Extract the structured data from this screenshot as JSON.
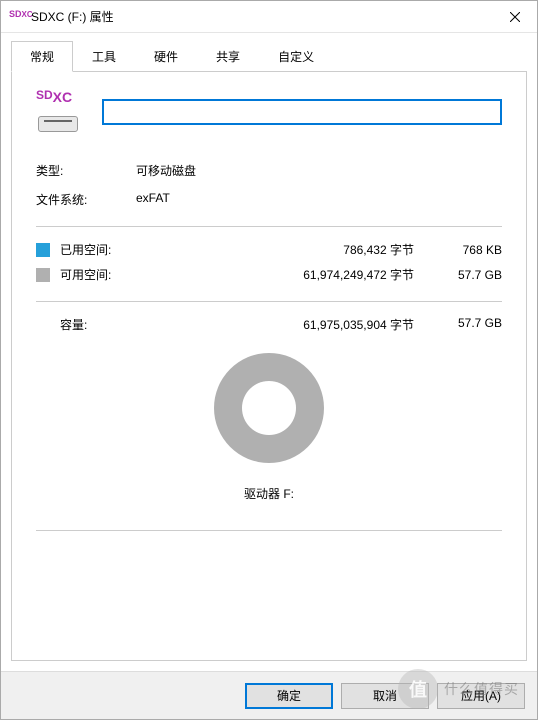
{
  "window": {
    "title": "SDXC (F:) 属性"
  },
  "tabs": {
    "general": "常规",
    "tools": "工具",
    "hardware": "硬件",
    "sharing": "共享",
    "customize": "自定义"
  },
  "drive": {
    "icon_label_sd": "SD",
    "icon_label_xc": "XC",
    "name_value": "",
    "type_label": "类型:",
    "type_value": "可移动磁盘",
    "fs_label": "文件系统:",
    "fs_value": "exFAT"
  },
  "space": {
    "used_label": "已用空间:",
    "used_bytes": "786,432 字节",
    "used_human": "768 KB",
    "free_label": "可用空间:",
    "free_bytes": "61,974,249,472 字节",
    "free_human": "57.7 GB",
    "capacity_label": "容量:",
    "capacity_bytes": "61,975,035,904 字节",
    "capacity_human": "57.7 GB",
    "drive_label": "驱动器 F:"
  },
  "buttons": {
    "ok": "确定",
    "cancel": "取消",
    "apply": "应用(A)"
  },
  "watermark": {
    "circle": "值",
    "text": "什么值得买"
  },
  "colors": {
    "used": "#26a0da",
    "free": "#b0b0b0",
    "accent": "#0078d7"
  }
}
